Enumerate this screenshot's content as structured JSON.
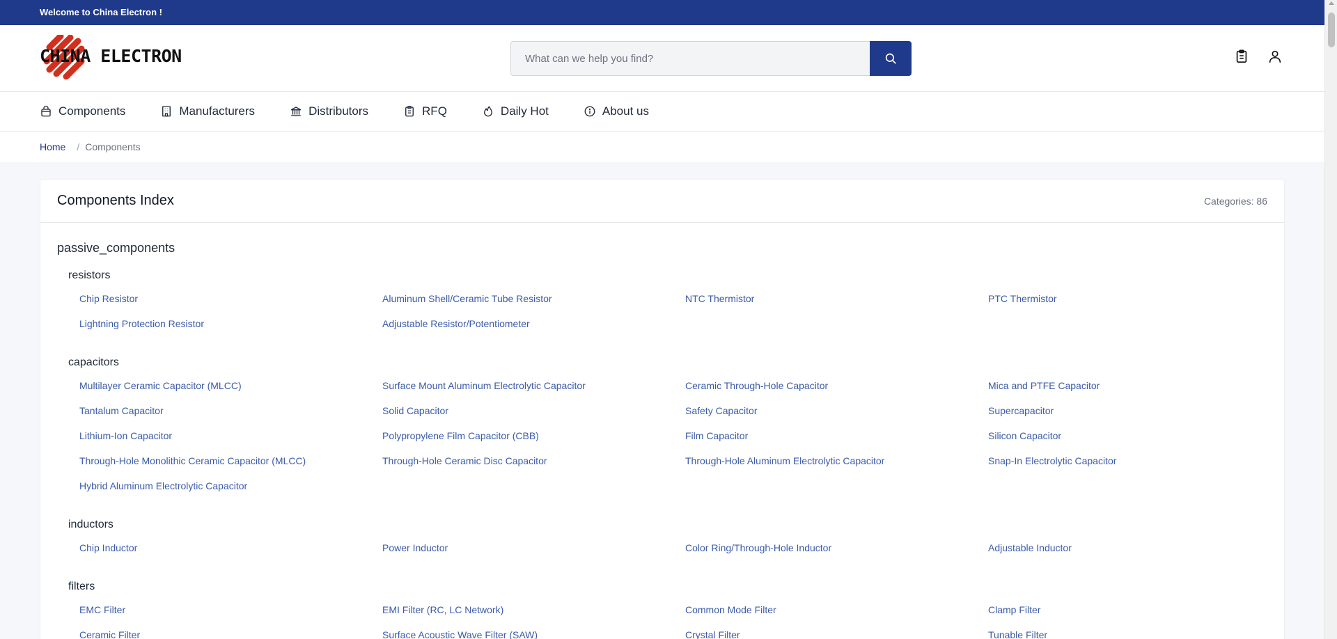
{
  "topbar": {
    "welcome": "Welcome to China Electron !"
  },
  "header": {
    "logo_text": "CHINA ELECTRON",
    "search_placeholder": "What can we help you find?",
    "icons": [
      "clipboard-icon",
      "user-icon"
    ]
  },
  "nav": [
    {
      "label": "Components",
      "icon": "bag-icon"
    },
    {
      "label": "Manufacturers",
      "icon": "building-icon"
    },
    {
      "label": "Distributors",
      "icon": "bank-icon"
    },
    {
      "label": "RFQ",
      "icon": "clipboard-list-icon"
    },
    {
      "label": "Daily Hot",
      "icon": "flame-icon"
    },
    {
      "label": "About us",
      "icon": "info-icon"
    }
  ],
  "breadcrumb": {
    "home": "Home",
    "separator": "/",
    "current": "Components"
  },
  "index": {
    "title": "Components Index",
    "count": "Categories: 86",
    "group": "passive_components",
    "subgroups": [
      {
        "name": "resistors",
        "items": [
          "Chip Resistor",
          "Aluminum Shell/Ceramic Tube Resistor",
          "NTC Thermistor",
          "PTC Thermistor",
          "Lightning Protection Resistor",
          "Adjustable Resistor/Potentiometer"
        ]
      },
      {
        "name": "capacitors",
        "items": [
          "Multilayer Ceramic Capacitor (MLCC)",
          "Surface Mount Aluminum Electrolytic Capacitor",
          "Ceramic Through-Hole Capacitor",
          "Mica and PTFE Capacitor",
          "Tantalum Capacitor",
          "Solid Capacitor",
          "Safety Capacitor",
          "Supercapacitor",
          "Lithium-Ion Capacitor",
          "Polypropylene Film Capacitor (CBB)",
          "Film Capacitor",
          "Silicon Capacitor",
          "Through-Hole Monolithic Ceramic Capacitor (MLCC)",
          "Through-Hole Ceramic Disc Capacitor",
          "Through-Hole Aluminum Electrolytic Capacitor",
          "Snap-In Electrolytic Capacitor",
          "Hybrid Aluminum Electrolytic Capacitor"
        ]
      },
      {
        "name": "inductors",
        "items": [
          "Chip Inductor",
          "Power Inductor",
          "Color Ring/Through-Hole Inductor",
          "Adjustable Inductor"
        ]
      },
      {
        "name": "filters",
        "items": [
          "EMC Filter",
          "EMI Filter (RC, LC Network)",
          "Common Mode Filter",
          "Clamp Filter",
          "Ceramic Filter",
          "Surface Acoustic Wave Filter (SAW)",
          "Crystal Filter",
          "Tunable Filter"
        ]
      }
    ]
  },
  "colors": {
    "brand": "#1f3a8a",
    "link": "#3b5ba9",
    "logo_red": "#d0311f"
  }
}
